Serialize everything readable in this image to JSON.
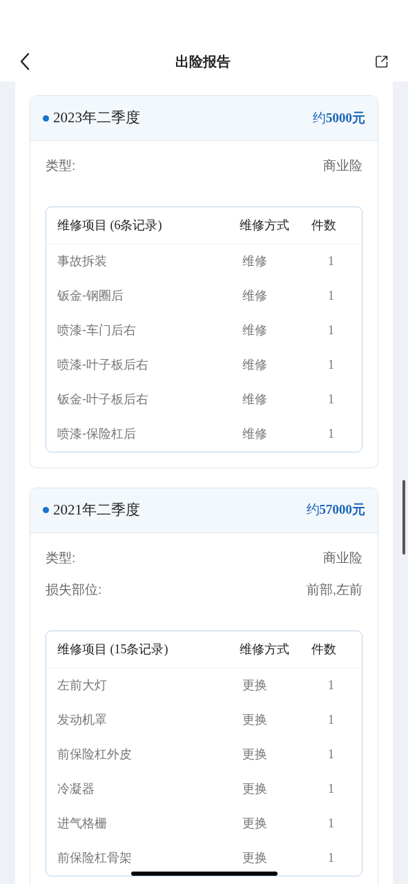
{
  "nav": {
    "title": "出险报告"
  },
  "reports": [
    {
      "period": "2023年二季度",
      "amount": "约**5000元**",
      "fields": [
        {
          "label": "类型:",
          "value": "商业险"
        }
      ],
      "table": {
        "columns": [
          "维修项目 (6条记录)",
          "维修方式",
          "件数"
        ],
        "rows": [
          {
            "item": "事故拆装",
            "method": "维修",
            "count": "1"
          },
          {
            "item": "钣金-钢圈后",
            "method": "维修",
            "count": "1"
          },
          {
            "item": "喷漆-车门后右",
            "method": "维修",
            "count": "1"
          },
          {
            "item": "喷漆-叶子板后右",
            "method": "维修",
            "count": "1"
          },
          {
            "item": "钣金-叶子板后右",
            "method": "维修",
            "count": "1"
          },
          {
            "item": "喷漆-保险杠后",
            "method": "维修",
            "count": "1"
          }
        ]
      }
    },
    {
      "period": "2021年二季度",
      "amount": "约**57000元**",
      "fields": [
        {
          "label": "类型:",
          "value": "商业险"
        },
        {
          "label": "损失部位:",
          "value": "前部,左前"
        }
      ],
      "table": {
        "columns": [
          "维修项目 (15条记录)",
          "维修方式",
          "件数"
        ],
        "rows": [
          {
            "item": "左前大灯",
            "method": "更换",
            "count": "1"
          },
          {
            "item": "发动机罩",
            "method": "更换",
            "count": "1"
          },
          {
            "item": "前保险杠外皮",
            "method": "更换",
            "count": "1"
          },
          {
            "item": "冷凝器",
            "method": "更换",
            "count": "1"
          },
          {
            "item": "进气格栅",
            "method": "更换",
            "count": "1"
          },
          {
            "item": "前保险杠骨架",
            "method": "更换",
            "count": "1"
          }
        ]
      }
    }
  ]
}
